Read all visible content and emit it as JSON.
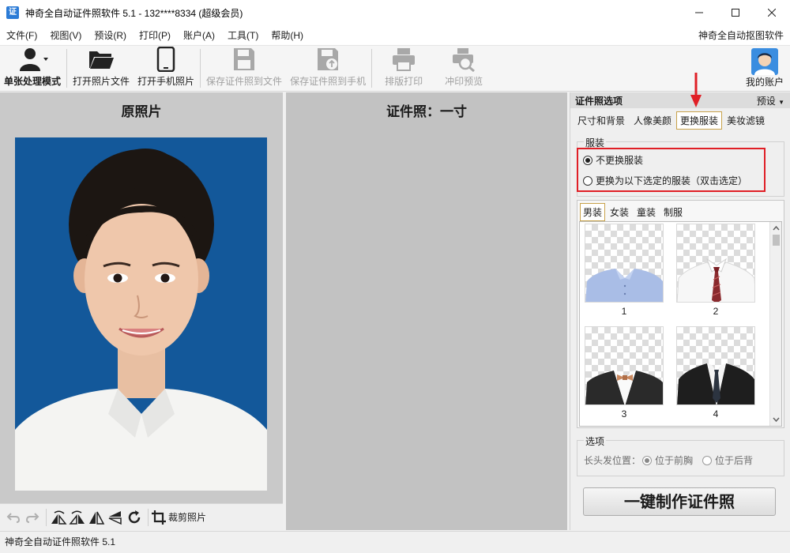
{
  "window": {
    "title": "神奇全自动证件照软件 5.1 - 132****8334 (超级会员)",
    "app_icon_text": "证"
  },
  "menu": {
    "items": [
      "文件(F)",
      "视图(V)",
      "预设(R)",
      "打印(P)",
      "账户(A)",
      "工具(T)",
      "帮助(H)"
    ],
    "right_link": "神奇全自动抠图软件"
  },
  "toolbar": {
    "mode": "单张处理模式",
    "open_file": "打开照片文件",
    "open_phone": "打开手机照片",
    "save_file": "保存证件照到文件",
    "save_phone": "保存证件照到手机",
    "layout_print": "排版打印",
    "print_preview": "冲印预览",
    "account": "我的账户"
  },
  "left_panel": {
    "title": "原照片",
    "crop_label": "裁剪照片"
  },
  "center_panel": {
    "title": "证件照：一寸"
  },
  "right_panel": {
    "header_title": "证件照选项",
    "header_preset": "预设",
    "tabs": [
      "尺寸和背景",
      "人像美颜",
      "更换服装",
      "美妆滤镜"
    ],
    "active_tab": "更换服装",
    "clothing_group": "服装",
    "radio_no_change": "不更换服装",
    "radio_change": "更换为以下选定的服装（双击选定）",
    "gallery_tabs": [
      "男装",
      "女装",
      "童装",
      "制服"
    ],
    "gallery_items": [
      "1",
      "2",
      "3",
      "4"
    ],
    "options_group": "选项",
    "hair_label": "长头发位置：",
    "hair_front": "位于前胸",
    "hair_back": "位于后背",
    "make_button": "一键制作证件照"
  },
  "statusbar": {
    "text": "神奇全自动证件照软件 5.1"
  },
  "colors": {
    "photo_background": "#13589a",
    "highlight_red": "#e01f26",
    "tab_border": "#c8a24b"
  }
}
